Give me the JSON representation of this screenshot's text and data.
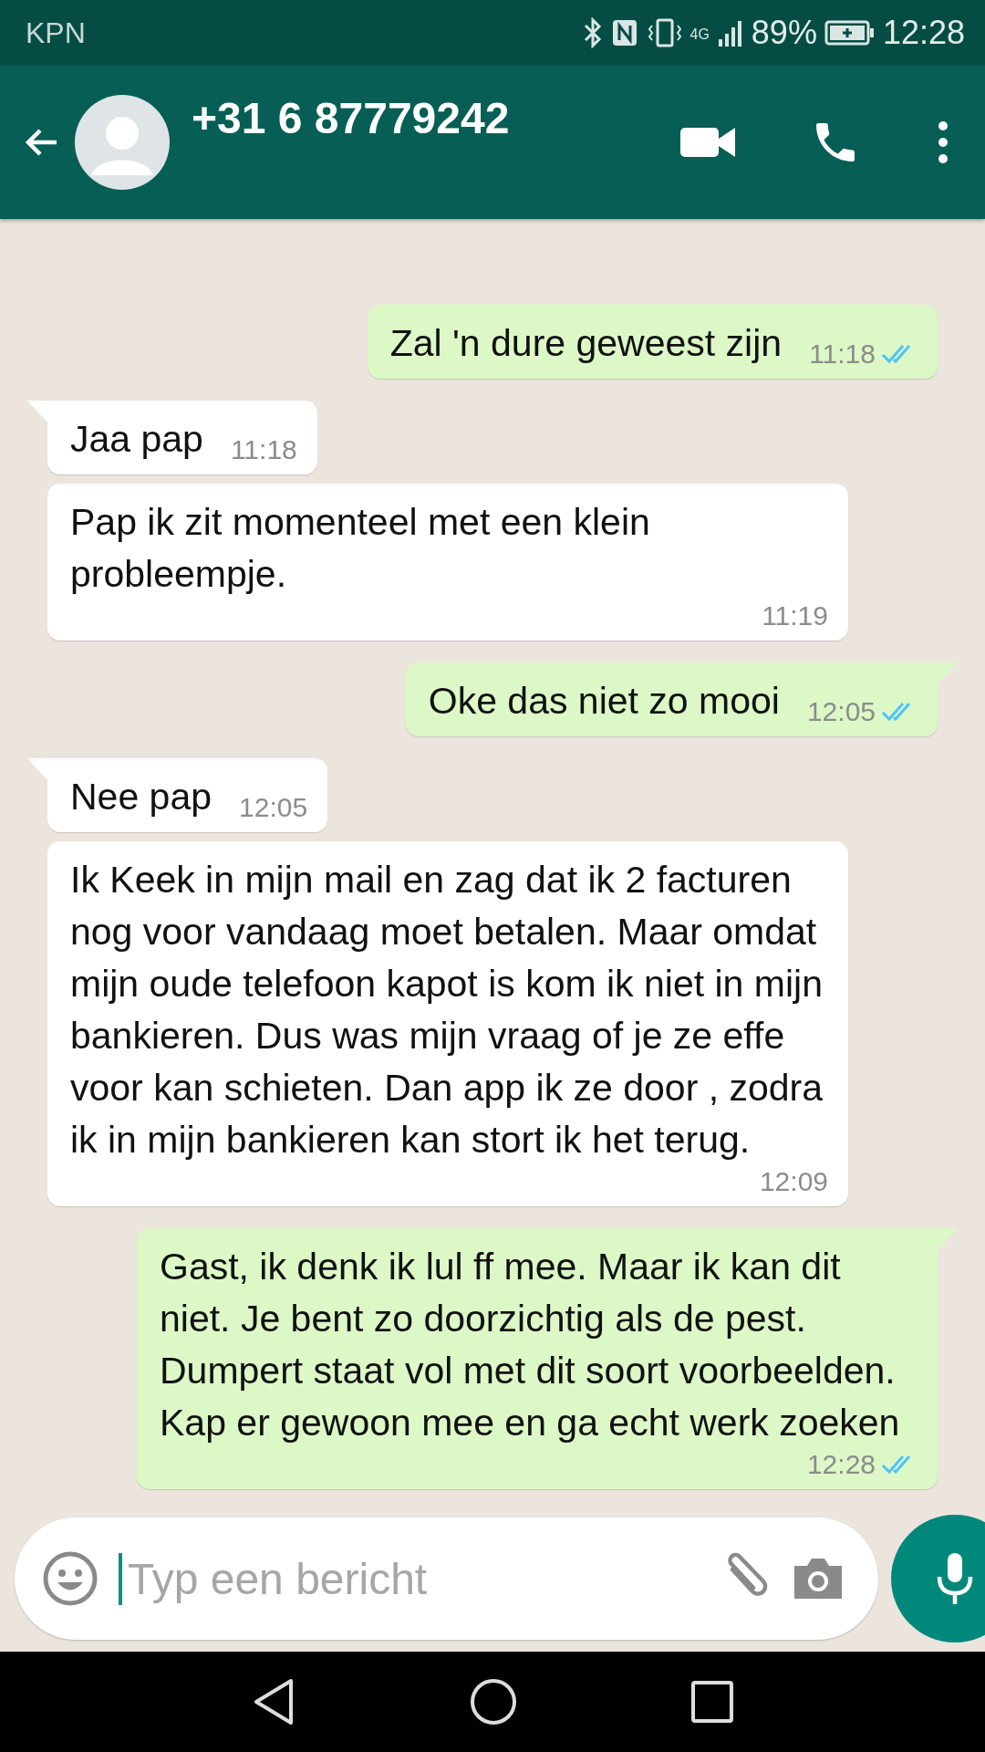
{
  "status_bar": {
    "carrier": "KPN",
    "network": "4G",
    "battery": "89%",
    "time": "12:28"
  },
  "header": {
    "contact": "+31 6 87779242"
  },
  "messages": [
    {
      "kind": "outgoing",
      "tail": false,
      "text": "Zal 'n dure geweest zijn",
      "time": "11:18",
      "read": true
    },
    {
      "kind": "incoming",
      "tail": true,
      "text": "Jaa pap",
      "time": "11:18"
    },
    {
      "kind": "incoming",
      "tail": false,
      "text": "Pap ik zit momenteel met een klein probleempje.",
      "time": "11:19"
    },
    {
      "kind": "outgoing",
      "tail": true,
      "text": "Oke das niet zo mooi",
      "time": "12:05",
      "read": true
    },
    {
      "kind": "incoming",
      "tail": true,
      "text": "Nee pap",
      "time": "12:05"
    },
    {
      "kind": "incoming",
      "tail": false,
      "text": "Ik Keek in mijn mail en zag dat ik 2 facturen nog voor vandaag moet betalen. Maar omdat mijn oude telefoon kapot is kom ik niet in mijn bankieren. Dus was mijn vraag of je ze effe voor kan schieten. Dan app ik ze door , zodra ik  in mijn bankieren kan stort ik het terug.",
      "time": "12:09"
    },
    {
      "kind": "outgoing",
      "tail": true,
      "text": "Gast, ik denk ik lul ff mee. Maar ik kan dit niet. Je bent zo doorzichtig als de pest. Dumpert staat vol met dit soort voorbeelden. Kap er gewoon mee en ga echt werk zoeken",
      "time": "12:28",
      "read": true
    }
  ],
  "composer": {
    "placeholder": "Typ een bericht"
  }
}
